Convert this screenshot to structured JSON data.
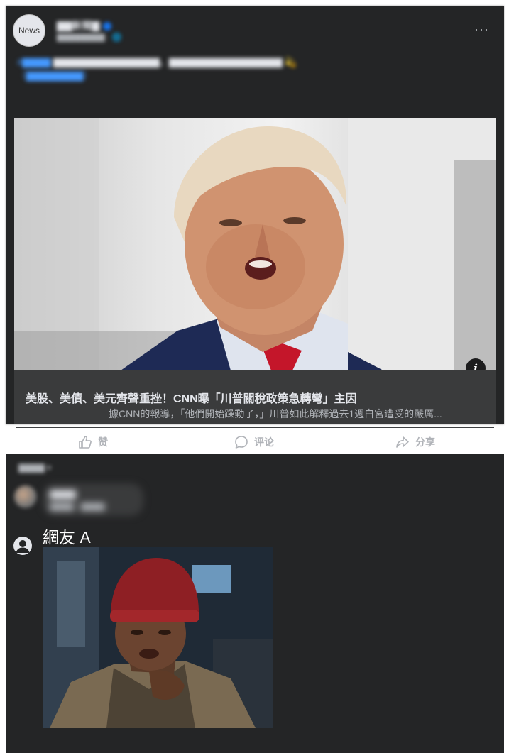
{
  "post": {
    "avatar_text": "News",
    "page_name": "▇▇新聞▇",
    "timestamp": "▇▇▇▇▇▇▇▇ · 🌐",
    "more_label": "···",
    "text_hashtag": "#▇▇▇▇",
    "text_body": "▇▇▇▇▇▇▇▇▇▇▇▇▇▇▇，▇▇▇▇▇▇▇▇▇▇▇▇▇▇▇▇ 💫",
    "text_link": "（▇▇▇▇▇▇▇▇）",
    "info_label": "i",
    "link_title": "美股、美債、美元齊聲重挫！CNN曝「川普關稅政策急轉彎」主因",
    "link_description": "據CNN的報導，「他們開始躁動了，」川普如此解釋過去1週白宮遭受的嚴厲..."
  },
  "actions": {
    "like": "赞",
    "comment": "评论",
    "share": "分享"
  },
  "comments": {
    "sort_label": "▇▇▇▇ ▾",
    "blurred_name": "▇▇▇▇",
    "blurred_text": "▇▇▇▇ · ▇▇▇▇",
    "commenter_name": "網友 A"
  },
  "colors": {
    "panel_bg": "#242526",
    "link_box_bg": "#3a3b3c",
    "text_primary": "#e4e6eb",
    "text_secondary": "#b0b3b8",
    "accent_blue": "#1877f2"
  }
}
